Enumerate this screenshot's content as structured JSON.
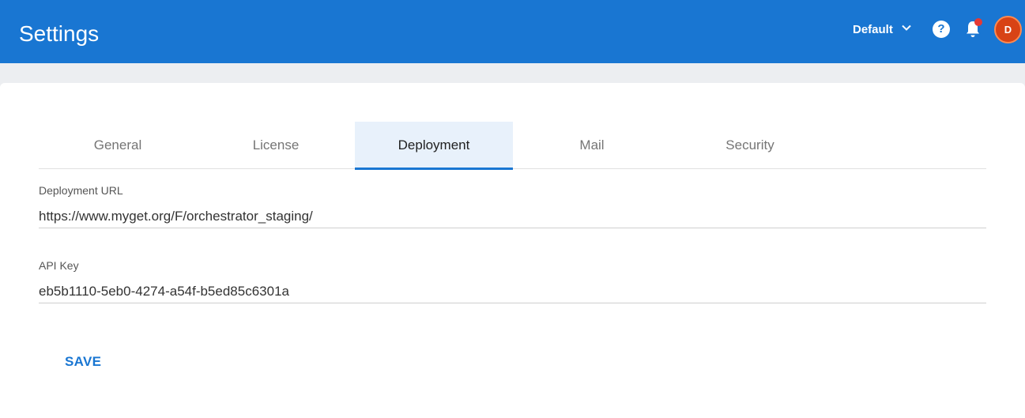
{
  "header": {
    "title": "Settings",
    "tenant": "Default",
    "help_glyph": "?",
    "user_initial": "D",
    "accent_color": "#1976d2",
    "icons": [
      "chevron-down-icon",
      "help-icon",
      "bell-icon",
      "notification-dot"
    ]
  },
  "tabs": [
    {
      "label": "General",
      "active": false
    },
    {
      "label": "License",
      "active": false
    },
    {
      "label": "Deployment",
      "active": true
    },
    {
      "label": "Mail",
      "active": false
    },
    {
      "label": "Security",
      "active": false
    }
  ],
  "form": {
    "deployment_url": {
      "label": "Deployment URL",
      "value": "https://www.myget.org/F/orchestrator_staging/"
    },
    "api_key": {
      "label": "API Key",
      "value": "eb5b1110-5eb0-4274-a54f-b5ed85c6301a"
    },
    "save_label": "SAVE"
  }
}
